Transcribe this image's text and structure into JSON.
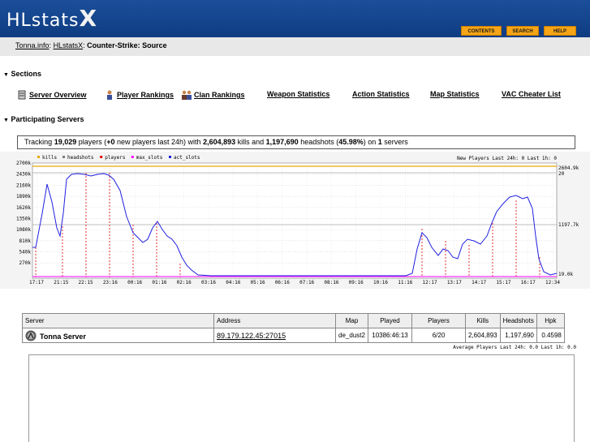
{
  "header": {
    "logo_main": "HLstats",
    "logo_x": "X",
    "buttons": [
      "CONTENTS",
      "SEARCH",
      "HELP"
    ]
  },
  "breadcrumb": {
    "site": "Tonna.info",
    "app": "HLstatsX",
    "current": "Counter-Strike: Source"
  },
  "sections": {
    "title": "Sections",
    "links": [
      "Server Overview",
      "Player Rankings",
      "Clan Rankings",
      "Weapon Statistics",
      "Action Statistics",
      "Map Statistics",
      "VAC Cheater List"
    ]
  },
  "participating": {
    "title": "Participating Servers",
    "tracking": {
      "prefix": "Tracking ",
      "players": "19,029",
      "mid1": " players (",
      "new_players": "+0",
      "mid2": " new players last 24h) with ",
      "kills": "2,604,893",
      "mid3": " kills and ",
      "headshots": "1,197,690",
      "mid4": " headshots (",
      "hs_percent": "45.98%",
      "mid5": ") on ",
      "servers": "1",
      "suffix": " servers"
    }
  },
  "graph": {
    "legend": [
      "kills",
      "headshots",
      "players",
      "max_slots",
      "act_slots"
    ],
    "legend_colors": [
      "#e6a800",
      "#808080",
      "#e00000",
      "#ff00ff",
      "#2020e0"
    ],
    "status": "New Players Last 24h: 0 Last 1h: 0",
    "y_ticks": [
      "2700k",
      "2430k",
      "2160k",
      "1890k",
      "1620k",
      "1350k",
      "1080k",
      "810k",
      "540k",
      "270k"
    ],
    "right_labels": [
      "2604.9k",
      "20",
      "1197.7k",
      "19.0k"
    ],
    "x_ticks": [
      "17:17",
      "21:15",
      "22:15",
      "23:16",
      "00:16",
      "01:16",
      "02:16",
      "03:16",
      "04:16",
      "05:16",
      "06:16",
      "07:16",
      "08:16",
      "09:16",
      "10:16",
      "11:16",
      "12:17",
      "13:17",
      "14:17",
      "15:17",
      "16:17",
      "12:34"
    ]
  },
  "servers_table": {
    "headers": [
      "Server",
      "Address",
      "Map",
      "Played",
      "Players",
      "Kills",
      "Headshots",
      "Hpk"
    ],
    "row": {
      "name": "Tonna Server",
      "address": "89.179.122.45:27015",
      "map": "de_dust2",
      "played": "10386:46:13",
      "players": "6/20",
      "kills": "2,604,893",
      "headshots": "1,197,690",
      "hpk": "0.4598"
    }
  },
  "avg_players": {
    "label": "Average Players Last 24h: 0.0 Last 1h: 0.0"
  }
}
